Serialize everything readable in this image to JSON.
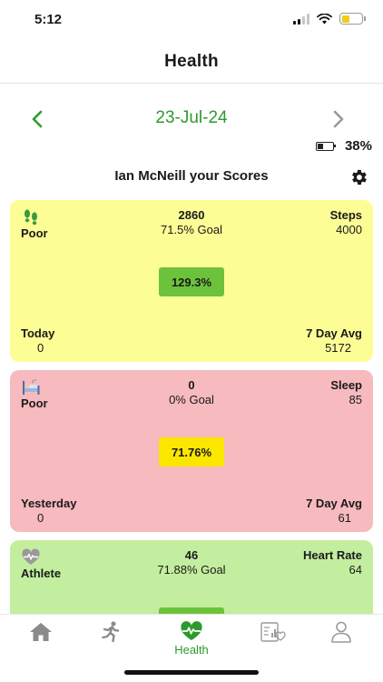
{
  "status_bar": {
    "time": "5:12"
  },
  "header": {
    "title": "Health"
  },
  "date_nav": {
    "date": "23-Jul-24"
  },
  "device": {
    "battery_text": "38%",
    "battery_level": 0.38
  },
  "scores_title": "Ian McNeill your Scores",
  "cards": [
    {
      "icon": "footprints-icon",
      "level": "Poor",
      "value": "2860",
      "goal": "71.5% Goal",
      "metric": "Steps",
      "target": "4000",
      "percent": "129.3%",
      "bottom_left_label": "Today",
      "bottom_left_value": "0",
      "bottom_right_label": "7 Day Avg",
      "bottom_right_value": "5172",
      "color": "#fdfd96",
      "badge_color": "#6dc23b"
    },
    {
      "icon": "sleep-bed-icon",
      "level": "Poor",
      "value": "0",
      "goal": "0% Goal",
      "metric": "Sleep",
      "target": "85",
      "percent": "71.76%",
      "bottom_left_label": "Yesterday",
      "bottom_left_value": "0",
      "bottom_right_label": "7 Day Avg",
      "bottom_right_value": "61",
      "color": "#f7babe",
      "badge_color": "#fbe600"
    },
    {
      "icon": "heart-pulse-icon",
      "level": "Athlete",
      "value": "46",
      "goal": "71.88% Goal",
      "metric": "Heart Rate",
      "target": "64",
      "color": "#c3ee9f",
      "badge_color": "#6dc23b"
    }
  ],
  "tabs": [
    {
      "icon": "home-icon"
    },
    {
      "icon": "running-icon"
    },
    {
      "icon": "heart-pulse-icon",
      "label": "Health",
      "active": true
    },
    {
      "icon": "report-chart-icon"
    },
    {
      "icon": "profile-icon"
    }
  ],
  "colors": {
    "accent": "#2e9a2e",
    "inactive": "#8a8a8a"
  }
}
